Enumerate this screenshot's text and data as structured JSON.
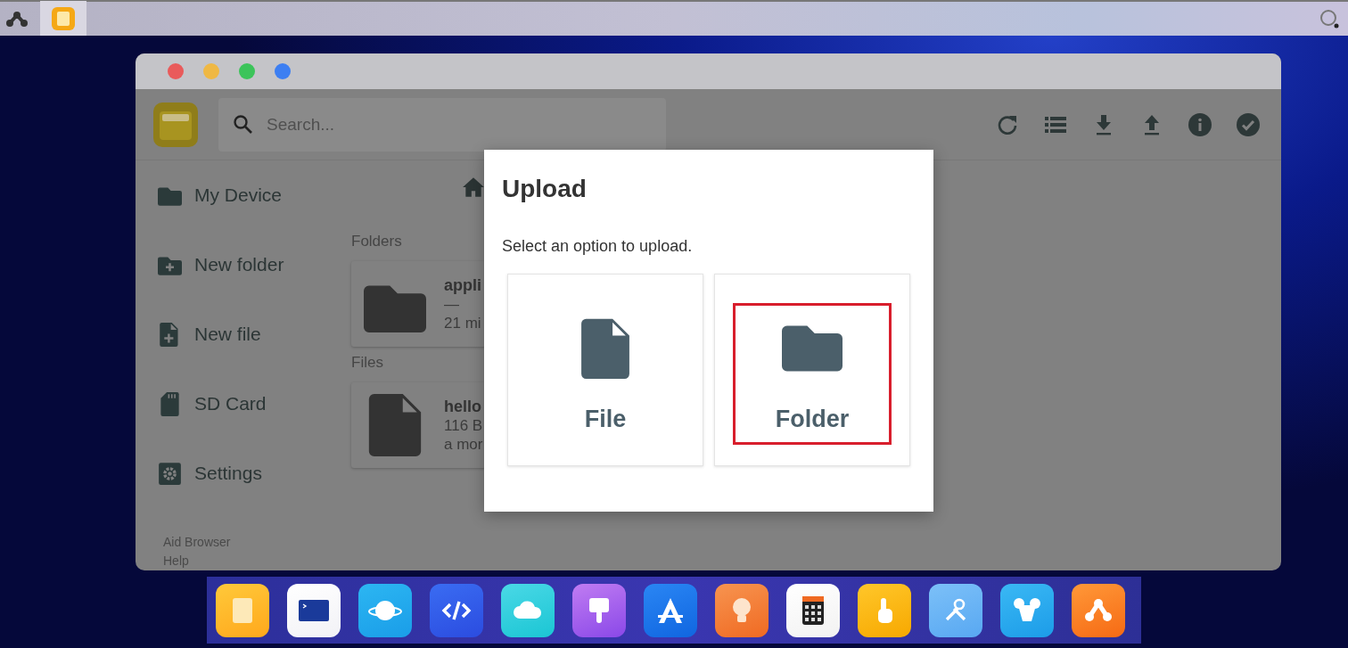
{
  "top_bar": {
    "apps": [
      {
        "kind": "files",
        "selected": true
      }
    ]
  },
  "window": {
    "search": {
      "placeholder": "Search..."
    },
    "toolbar": [
      {
        "kind": "refresh"
      },
      {
        "kind": "list"
      },
      {
        "kind": "download"
      },
      {
        "kind": "upload"
      },
      {
        "kind": "info"
      },
      {
        "kind": "select"
      }
    ],
    "sidebar": {
      "items": [
        {
          "kind": "device",
          "label": "My Device"
        },
        {
          "kind": "new_folder",
          "label": "New folder"
        },
        {
          "kind": "new_file",
          "label": "New file"
        },
        {
          "kind": "sd_card",
          "label": "SD Card"
        },
        {
          "kind": "settings",
          "label": "Settings"
        }
      ],
      "footer": [
        "Aid Browser",
        "Help"
      ]
    },
    "sections": [
      {
        "kind": "folder",
        "title": "Folders",
        "items": [
          {
            "name": "appli",
            "lines": [
              "—",
              "21 mi"
            ]
          }
        ]
      },
      {
        "kind": "file",
        "title": "Files",
        "items": [
          {
            "name": "hello",
            "lines": [
              "116 B",
              "a mor"
            ]
          }
        ]
      }
    ]
  },
  "dialog": {
    "title": "Upload",
    "message": "Select an option to upload.",
    "options": [
      {
        "kind": "file",
        "label": "File",
        "selected": false
      },
      {
        "kind": "folder",
        "label": "Folder",
        "selected": true
      }
    ]
  },
  "dock": [
    {
      "kind": "files"
    },
    {
      "kind": "terminal"
    },
    {
      "kind": "planet"
    },
    {
      "kind": "code"
    },
    {
      "kind": "cloud"
    },
    {
      "kind": "brush"
    },
    {
      "kind": "store"
    },
    {
      "kind": "bulb"
    },
    {
      "kind": "calculator"
    },
    {
      "kind": "touch"
    },
    {
      "kind": "tools"
    },
    {
      "kind": "mouse"
    },
    {
      "kind": "aid"
    }
  ]
}
